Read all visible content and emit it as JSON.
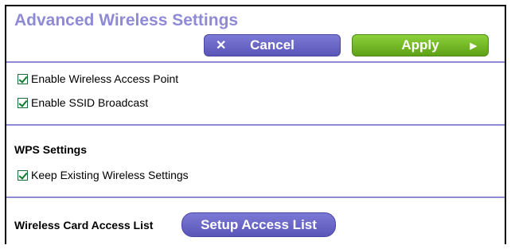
{
  "page": {
    "title": "Advanced Wireless Settings"
  },
  "toolbar": {
    "cancel_label": "Cancel",
    "apply_label": "Apply",
    "cancel_icon": "close-icon",
    "apply_icon": "arrow-right-icon"
  },
  "settings": {
    "enable_ap_label": "Enable Wireless Access Point",
    "enable_ap_checked": true,
    "enable_ssid_label": "Enable SSID Broadcast",
    "enable_ssid_checked": true
  },
  "wps": {
    "heading": "WPS Settings",
    "keep_existing_label": "Keep Existing Wireless Settings",
    "keep_existing_checked": true
  },
  "access_list": {
    "label": "Wireless Card Access List",
    "button_label": "Setup Access List"
  },
  "colors": {
    "accent": "#8e8ad6",
    "cancel_button": "#6b67c7",
    "apply_button": "#76bb26"
  }
}
